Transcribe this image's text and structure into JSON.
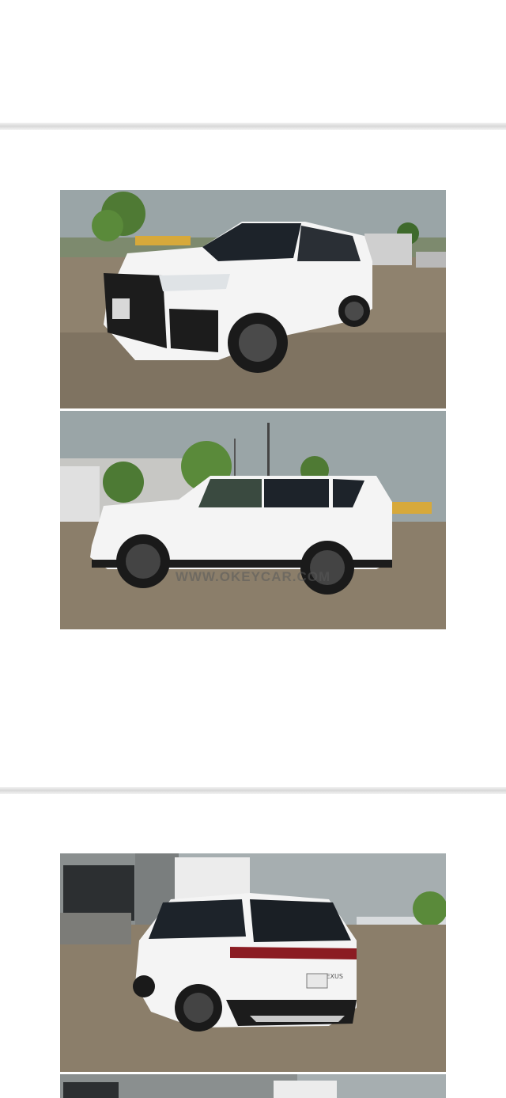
{
  "gallery": {
    "watermark": "WWW.OKEYCAR.COM",
    "rear_badge": "LEXUS",
    "photos": [
      {
        "view": "front-three-quarter",
        "subject": "white-suv"
      },
      {
        "view": "side-profile",
        "subject": "white-suv"
      },
      {
        "view": "rear-three-quarter",
        "subject": "white-suv"
      },
      {
        "view": "partial-next",
        "subject": "white-suv"
      }
    ]
  },
  "colors": {
    "page_bg": "#ffffff",
    "separator": "#dcdcdc",
    "sky": "#9aa5a7",
    "ground": "#8a7d6a",
    "car_body": "#f4f4f4",
    "trim": "#1c1c1c"
  }
}
